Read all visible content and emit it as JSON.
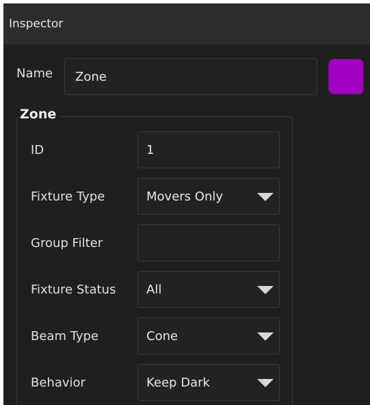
{
  "window": {
    "title": "Inspector"
  },
  "name_field": {
    "label": "Name",
    "value": "Zone",
    "color": "#a100c4"
  },
  "group": {
    "title": "Zone",
    "fields": {
      "id": {
        "label": "ID",
        "value": "1"
      },
      "fixture_type": {
        "label": "Fixture Type",
        "value": "Movers Only"
      },
      "group_filter": {
        "label": "Group Filter",
        "value": ""
      },
      "fixture_status": {
        "label": "Fixture Status",
        "value": "All"
      },
      "beam_type": {
        "label": "Beam Type",
        "value": "Cone"
      },
      "behavior": {
        "label": "Behavior",
        "value": "Keep Dark"
      }
    }
  },
  "icons": {
    "dropdown": "chevron-down-icon"
  }
}
